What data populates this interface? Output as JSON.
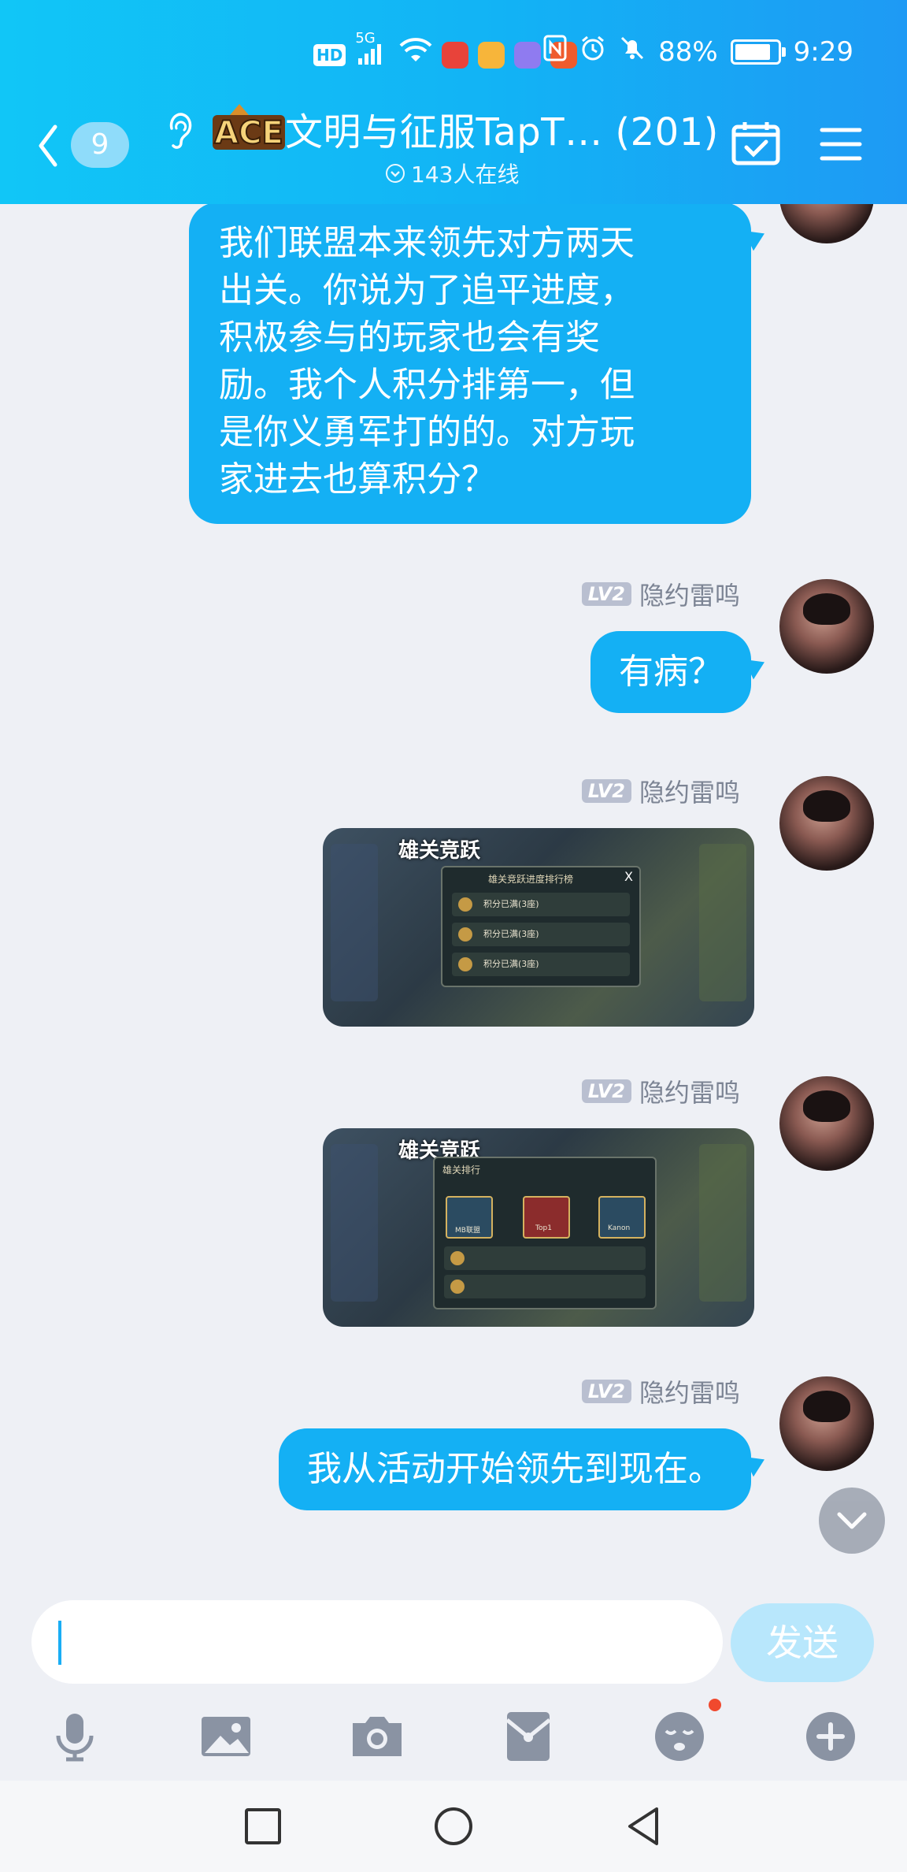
{
  "status_bar": {
    "network": "HD",
    "signal_label": "5G",
    "battery_percent": "88%",
    "time": "9:29",
    "icons": [
      "signal-icon",
      "wifi-icon",
      "app-icon-red",
      "app-icon-yellow",
      "app-icon-purple",
      "app-icon-red2",
      "nfc-icon",
      "alarm-icon",
      "mute-icon",
      "battery-icon"
    ]
  },
  "header": {
    "back_count": "9",
    "title": "文明与征服TapT… (201)",
    "online": "143人在线",
    "logo_text": "ACE"
  },
  "messages": [
    {
      "type": "text",
      "text": [
        "我们联盟本来领先对方两天",
        "出关。你说为了追平进度，",
        "积极参与的玩家也会有奖",
        "励。我个人积分排第一，但",
        "是你义勇军打的的。对方玩",
        "家进去也算积分？"
      ]
    },
    {
      "type": "text",
      "level": "LV2",
      "sender": "隐约雷鸣",
      "text": "有病？"
    },
    {
      "type": "image",
      "level": "LV2",
      "sender": "隐约雷鸣",
      "image_title": "雄关竞跃",
      "image_header": "雄关竞跃进度排行榜",
      "image_rows": [
        "积分已满(3座)",
        "积分已满(3座)",
        "积分已满(3座)"
      ]
    },
    {
      "type": "image",
      "level": "LV2",
      "sender": "隐约雷鸣",
      "image_title": "雄关竞跃",
      "image_header": "雄关排行",
      "image_cards": [
        "MB联盟",
        "Top1",
        "Kanon"
      ]
    },
    {
      "type": "text",
      "level": "LV2",
      "sender": "隐约雷鸣",
      "text": "我从活动开始领先到现在。"
    }
  ],
  "input": {
    "placeholder": "",
    "send_label": "发送"
  },
  "toolbar": [
    "microphone-icon",
    "image-icon",
    "camera-icon",
    "red-packet-icon",
    "emoji-icon",
    "plus-icon"
  ],
  "colors": {
    "accent": "#14b0f4",
    "header_start": "#11c6f7",
    "header_end": "#1e9af4",
    "background": "#eef0f5"
  }
}
